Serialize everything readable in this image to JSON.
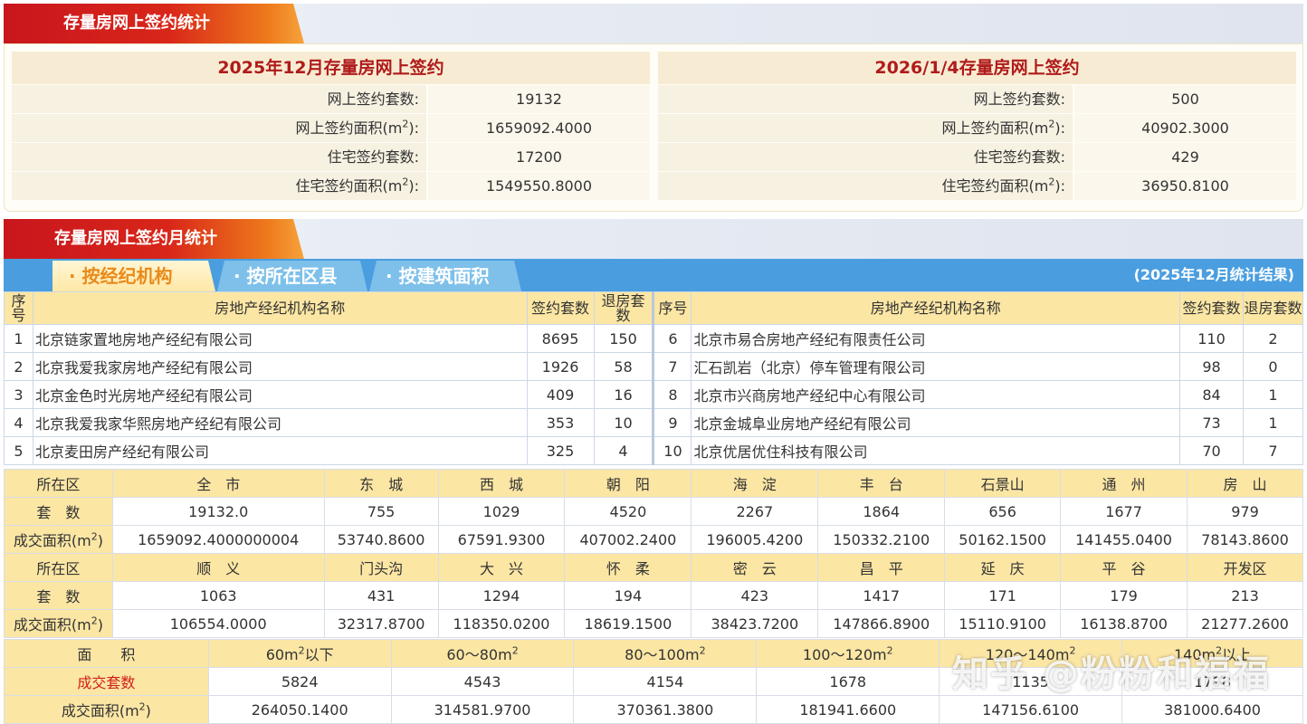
{
  "section1": {
    "title": "存量房网上签约统计"
  },
  "left_panel": {
    "title": "2025年12月存量房网上签约",
    "rows": [
      {
        "label": "网上签约套数:",
        "value": "19132"
      },
      {
        "label": "网上签约面积(m2):",
        "value": "1659092.4000"
      },
      {
        "label": "住宅签约套数:",
        "value": "17200"
      },
      {
        "label": "住宅签约面积(m2):",
        "value": "1549550.8000"
      }
    ]
  },
  "right_panel": {
    "title": "2026/1/4存量房网上签约",
    "rows": [
      {
        "label": "网上签约套数:",
        "value": "500"
      },
      {
        "label": "网上签约面积(m2):",
        "value": "40902.3000"
      },
      {
        "label": "住宅签约套数:",
        "value": "429"
      },
      {
        "label": "住宅签约面积(m2):",
        "value": "36950.8100"
      }
    ]
  },
  "section2": {
    "title": "存量房网上签约月统计"
  },
  "tabs": {
    "items": [
      "· 按经纪机构",
      "· 按所在区县",
      "· 按建筑面积"
    ],
    "active": 0,
    "note": "(2025年12月统计结果)"
  },
  "agency_table": {
    "headers": {
      "no": "序号",
      "name": "房地产经纪机构名称",
      "signed": "签约套数",
      "returned": "退房套数"
    },
    "left": [
      {
        "no": "1",
        "name": "北京链家置地房地产经纪有限公司",
        "signed": "8695",
        "returned": "150"
      },
      {
        "no": "2",
        "name": "北京我爱我家房地产经纪有限公司",
        "signed": "1926",
        "returned": "58"
      },
      {
        "no": "3",
        "name": "北京金色时光房地产经纪有限公司",
        "signed": "409",
        "returned": "16"
      },
      {
        "no": "4",
        "name": "北京我爱我家华熙房地产经纪有限公司",
        "signed": "353",
        "returned": "10"
      },
      {
        "no": "5",
        "name": "北京麦田房产经纪有限公司",
        "signed": "325",
        "returned": "4"
      }
    ],
    "right": [
      {
        "no": "6",
        "name": "北京市易合房地产经纪有限责任公司",
        "signed": "110",
        "returned": "2"
      },
      {
        "no": "7",
        "name": "汇石凯岩（北京）停车管理有限公司",
        "signed": "98",
        "returned": "0"
      },
      {
        "no": "8",
        "name": "北京市兴商房地产经纪中心有限公司",
        "signed": "84",
        "returned": "1"
      },
      {
        "no": "9",
        "name": "北京金城阜业房地产经纪有限公司",
        "signed": "73",
        "returned": "1"
      },
      {
        "no": "10",
        "name": "北京优居优住科技有限公司",
        "signed": "70",
        "returned": "7"
      }
    ]
  },
  "district_table": {
    "label_district": "所在区",
    "label_count": "套　数",
    "label_area": "成交面积(m2)",
    "block1": {
      "districts": [
        "全　市",
        "东　城",
        "西　城",
        "朝　阳",
        "海　淀",
        "丰　台",
        "石景山",
        "通　州",
        "房　山"
      ],
      "counts": [
        "19132.0",
        "755",
        "1029",
        "4520",
        "2267",
        "1864",
        "656",
        "1677",
        "979"
      ],
      "areas": [
        "1659092.4000000004",
        "53740.8600",
        "67591.9300",
        "407002.2400",
        "196005.4200",
        "150332.2100",
        "50162.1500",
        "141455.0400",
        "78143.8600"
      ]
    },
    "block2": {
      "districts": [
        "顺　义",
        "门头沟",
        "大　兴",
        "怀　柔",
        "密　云",
        "昌　平",
        "延　庆",
        "平　谷",
        "开发区"
      ],
      "counts": [
        "1063",
        "431",
        "1294",
        "194",
        "423",
        "1417",
        "171",
        "179",
        "213"
      ],
      "areas": [
        "106554.0000",
        "32317.8700",
        "118350.0200",
        "18619.1500",
        "38423.7200",
        "147866.8900",
        "15110.9100",
        "16138.8700",
        "21277.2600"
      ]
    }
  },
  "area_table": {
    "label_area": "面　　积",
    "label_count": "成交套数",
    "label_sqm": "成交面积(m2)",
    "ranges": [
      "60m2以下",
      "60～80m2",
      "80～100m2",
      "100～120m2",
      "120～140m2",
      "140m2以上"
    ],
    "counts": [
      "5824",
      "4543",
      "4154",
      "1678",
      "1135",
      "1798"
    ],
    "areas": [
      "264050.1400",
      "314581.9700",
      "370361.3800",
      "181941.6600",
      "147156.6100",
      "381000.6400"
    ]
  },
  "watermark": "知乎 @粉粉和福福"
}
